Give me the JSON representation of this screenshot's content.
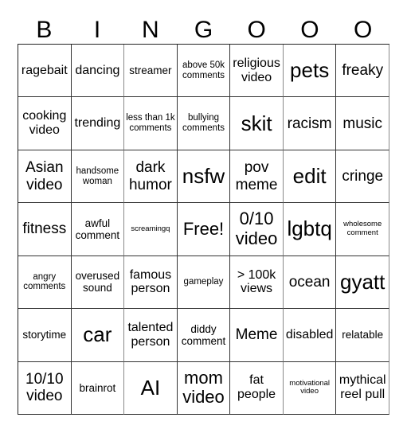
{
  "header": {
    "letters": [
      "B",
      "I",
      "N",
      "G",
      "O",
      "O",
      "O"
    ]
  },
  "board": {
    "rows": [
      [
        "ragebait",
        "dancing",
        "streamer",
        "above 50k comments",
        "religious video",
        "pets",
        "freaky"
      ],
      [
        "cooking video",
        "trending",
        "less than 1k comments",
        "bullying comments",
        "skit",
        "racism",
        "music"
      ],
      [
        "Asian video",
        "handsome woman",
        "dark humor",
        "nsfw",
        "pov meme",
        "edit",
        "cringe"
      ],
      [
        "fitness",
        "awful comment",
        "screamingq",
        "Free!",
        "0/10 video",
        "lgbtq",
        "wholesome comment"
      ],
      [
        "angry comments",
        "overused sound",
        "famous person",
        "gameplay",
        "> 100k views",
        "ocean",
        "gyatt"
      ],
      [
        "storytime",
        "car",
        "talented person",
        "diddy comment",
        "Meme",
        "disabled",
        "relatable"
      ],
      [
        "10/10 video",
        "brainrot",
        "AI",
        "mom video",
        "fat people",
        "motivational video",
        "mythical reel pull"
      ]
    ],
    "free_space": "Free!"
  }
}
